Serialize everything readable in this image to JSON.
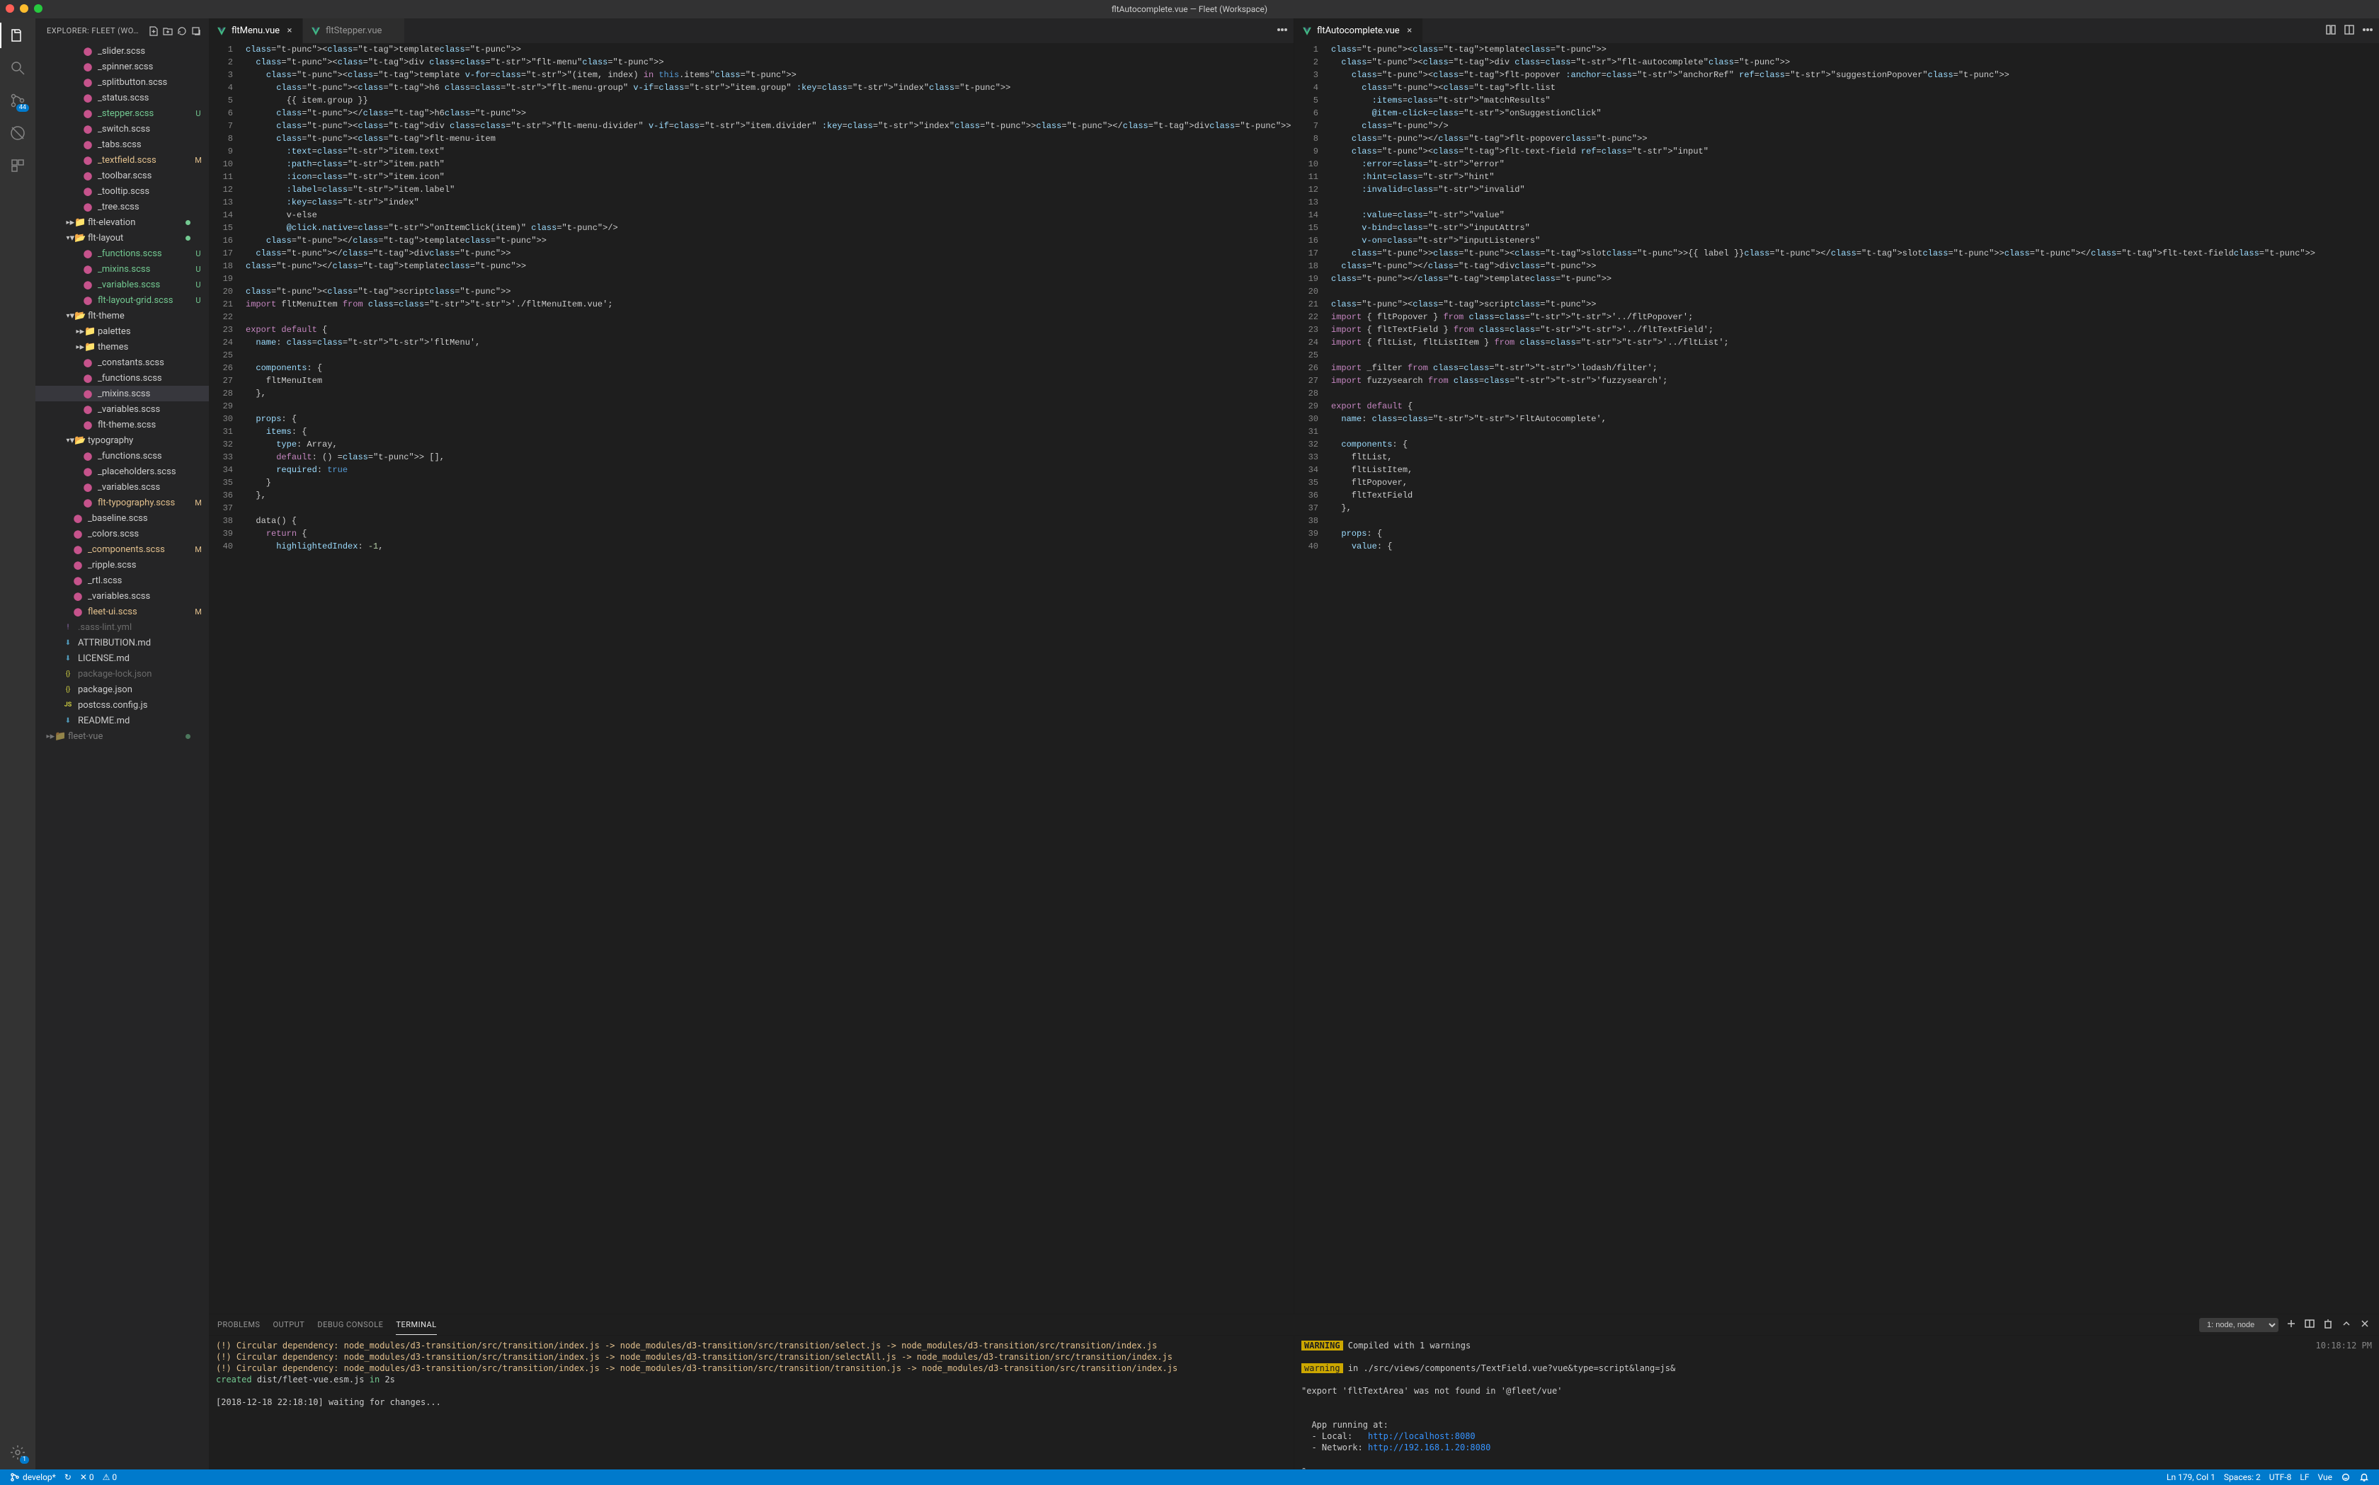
{
  "window": {
    "title": "fltAutocomplete.vue — Fleet (Workspace)"
  },
  "activity": {
    "scm_badge": "44",
    "settings_badge": "1"
  },
  "sidebar": {
    "title": "EXPLORER: FLEET (WO…",
    "items": [
      {
        "depth": 3,
        "kind": "sass",
        "name": "_slider.scss",
        "git": ""
      },
      {
        "depth": 3,
        "kind": "sass",
        "name": "_spinner.scss",
        "git": ""
      },
      {
        "depth": 3,
        "kind": "sass",
        "name": "_splitbutton.scss",
        "git": ""
      },
      {
        "depth": 3,
        "kind": "sass",
        "name": "_status.scss",
        "git": ""
      },
      {
        "depth": 3,
        "kind": "sass",
        "name": "_stepper.scss",
        "git": "U"
      },
      {
        "depth": 3,
        "kind": "sass",
        "name": "_switch.scss",
        "git": ""
      },
      {
        "depth": 3,
        "kind": "sass",
        "name": "_tabs.scss",
        "git": ""
      },
      {
        "depth": 3,
        "kind": "sass",
        "name": "_textfield.scss",
        "git": "M"
      },
      {
        "depth": 3,
        "kind": "sass",
        "name": "_toolbar.scss",
        "git": ""
      },
      {
        "depth": 3,
        "kind": "sass",
        "name": "_tooltip.scss",
        "git": ""
      },
      {
        "depth": 3,
        "kind": "sass",
        "name": "_tree.scss",
        "git": ""
      },
      {
        "depth": 2,
        "kind": "folder-closed",
        "name": "flt-elevation",
        "git": "",
        "dot": true
      },
      {
        "depth": 2,
        "kind": "folder-open",
        "name": "flt-layout",
        "git": "",
        "dot": true
      },
      {
        "depth": 3,
        "kind": "sass",
        "name": "_functions.scss",
        "git": "U"
      },
      {
        "depth": 3,
        "kind": "sass",
        "name": "_mixins.scss",
        "git": "U"
      },
      {
        "depth": 3,
        "kind": "sass",
        "name": "_variables.scss",
        "git": "U"
      },
      {
        "depth": 3,
        "kind": "sass",
        "name": "flt-layout-grid.scss",
        "git": "U"
      },
      {
        "depth": 2,
        "kind": "folder-open",
        "name": "flt-theme",
        "git": ""
      },
      {
        "depth": 3,
        "kind": "folder-closed",
        "name": "palettes",
        "git": ""
      },
      {
        "depth": 3,
        "kind": "folder-closed",
        "name": "themes",
        "git": ""
      },
      {
        "depth": 3,
        "kind": "sass",
        "name": "_constants.scss",
        "git": ""
      },
      {
        "depth": 3,
        "kind": "sass",
        "name": "_functions.scss",
        "git": ""
      },
      {
        "depth": 3,
        "kind": "sass",
        "name": "_mixins.scss",
        "git": "",
        "selected": true
      },
      {
        "depth": 3,
        "kind": "sass",
        "name": "_variables.scss",
        "git": ""
      },
      {
        "depth": 3,
        "kind": "sass",
        "name": "flt-theme.scss",
        "git": ""
      },
      {
        "depth": 2,
        "kind": "folder-open",
        "name": "typography",
        "git": ""
      },
      {
        "depth": 3,
        "kind": "sass",
        "name": "_functions.scss",
        "git": ""
      },
      {
        "depth": 3,
        "kind": "sass",
        "name": "_placeholders.scss",
        "git": ""
      },
      {
        "depth": 3,
        "kind": "sass",
        "name": "_variables.scss",
        "git": ""
      },
      {
        "depth": 3,
        "kind": "sass",
        "name": "flt-typography.scss",
        "git": "M"
      },
      {
        "depth": 2,
        "kind": "sass",
        "name": "_baseline.scss",
        "git": ""
      },
      {
        "depth": 2,
        "kind": "sass",
        "name": "_colors.scss",
        "git": ""
      },
      {
        "depth": 2,
        "kind": "sass",
        "name": "_components.scss",
        "git": "M"
      },
      {
        "depth": 2,
        "kind": "sass",
        "name": "_ripple.scss",
        "git": ""
      },
      {
        "depth": 2,
        "kind": "sass",
        "name": "_rtl.scss",
        "git": ""
      },
      {
        "depth": 2,
        "kind": "sass",
        "name": "_variables.scss",
        "git": ""
      },
      {
        "depth": 2,
        "kind": "sass",
        "name": "fleet-ui.scss",
        "git": "M"
      },
      {
        "depth": 1,
        "kind": "yml",
        "name": ".sass-lint.yml",
        "git": "",
        "ignored": true
      },
      {
        "depth": 1,
        "kind": "md",
        "name": "ATTRIBUTION.md",
        "git": ""
      },
      {
        "depth": 1,
        "kind": "md",
        "name": "LICENSE.md",
        "git": ""
      },
      {
        "depth": 1,
        "kind": "json",
        "name": "package-lock.json",
        "git": "",
        "ignored": true
      },
      {
        "depth": 1,
        "kind": "json",
        "name": "package.json",
        "git": ""
      },
      {
        "depth": 1,
        "kind": "js",
        "name": "postcss.config.js",
        "git": ""
      },
      {
        "depth": 1,
        "kind": "md",
        "name": "README.md",
        "git": ""
      },
      {
        "depth": 0,
        "kind": "folder-closed",
        "name": "fleet-vue",
        "git": "",
        "dot": true,
        "cut": true
      }
    ]
  },
  "editors": {
    "left": {
      "tabs": [
        {
          "name": "fltMenu.vue",
          "active": true,
          "close": true,
          "icon": "vue"
        },
        {
          "name": "fltStepper.vue",
          "active": false,
          "close": false,
          "icon": "vue"
        }
      ],
      "lines": [
        "<template>",
        "  <div class=\"flt-menu\">",
        "    <template v-for=\"(item, index) in this.items\">",
        "      <h6 class=\"flt-menu-group\" v-if=\"item.group\" :key=\"index\">",
        "        {{ item.group }}",
        "      </h6>",
        "      <div class=\"flt-menu-divider\" v-if=\"item.divider\" :key=\"index\"></div>",
        "      <flt-menu-item",
        "        :text=\"item.text\"",
        "        :path=\"item.path\"",
        "        :icon=\"item.icon\"",
        "        :label=\"item.label\"",
        "        :key=\"index\"",
        "        v-else",
        "        @click.native=\"onItemClick(item)\" />",
        "    </template>",
        "  </div>",
        "</template>",
        "",
        "<script>",
        "import fltMenuItem from './fltMenuItem.vue';",
        "",
        "export default {",
        "  name: 'fltMenu',",
        "",
        "  components: {",
        "    fltMenuItem",
        "  },",
        "",
        "  props: {",
        "    items: {",
        "      type: Array,",
        "      default: () => [],",
        "      required: true",
        "    }",
        "  },",
        "",
        "  data() {",
        "    return {",
        "      highlightedIndex: -1,"
      ]
    },
    "right": {
      "tabs": [
        {
          "name": "fltAutocomplete.vue",
          "active": true,
          "close": true,
          "icon": "vue"
        }
      ],
      "lines": [
        "<template>",
        "  <div class=\"flt-autocomplete\">",
        "    <flt-popover :anchor=\"anchorRef\" ref=\"suggestionPopover\">",
        "      <flt-list",
        "        :items=\"matchResults\"",
        "        @item-click=\"onSuggestionClick\"",
        "      />",
        "    </flt-popover>",
        "    <flt-text-field ref=\"input\"",
        "      :error=\"error\"",
        "      :hint=\"hint\"",
        "      :invalid=\"invalid\"",
        "",
        "      :value=\"value\"",
        "      v-bind=\"inputAttrs\"",
        "      v-on=\"inputListeners\"",
        "    ><slot>{{ label }}</slot></flt-text-field>",
        "  </div>",
        "</template>",
        "",
        "<script>",
        "import { fltPopover } from '../fltPopover';",
        "import { fltTextField } from '../fltTextField';",
        "import { fltList, fltListItem } from '../fltList';",
        "",
        "import _filter from 'lodash/filter';",
        "import fuzzysearch from 'fuzzysearch';",
        "",
        "export default {",
        "  name: 'FltAutocomplete',",
        "",
        "  components: {",
        "    fltList,",
        "    fltListItem,",
        "    fltPopover,",
        "    fltTextField",
        "  },",
        "",
        "  props: {",
        "    value: {"
      ]
    }
  },
  "panel": {
    "tabs": {
      "problems": "Problems",
      "output": "Output",
      "debug": "Debug Console",
      "terminal": "Terminal"
    },
    "terminal_select": "1: node, node",
    "left_term": [
      {
        "cls": "ylw",
        "text": "(!) Circular dependency: node_modules/d3-transition/src/transition/index.js -> node_modules/d3-transition/src/transition/select.js -> node_modules/d3-transition/src/transition/index.js"
      },
      {
        "cls": "ylw",
        "text": "(!) Circular dependency: node_modules/d3-transition/src/transition/index.js -> node_modules/d3-transition/src/transition/selectAll.js -> node_modules/d3-transition/src/transition/index.js"
      },
      {
        "cls": "ylw",
        "text": "(!) Circular dependency: node_modules/d3-transition/src/transition/index.js -> node_modules/d3-transition/src/transition/transition.js -> node_modules/d3-transition/src/transition/index.js"
      },
      {
        "cls": "grn",
        "text": "created dist/fleet-vue.esm.js in 2s"
      },
      {
        "cls": "dim",
        "text": ""
      },
      {
        "cls": "dim",
        "text": "[2018-12-18 22:18:10] waiting for changes..."
      }
    ],
    "right_term": {
      "time": "10:18:12 PM",
      "line1_a": "WARNING",
      "line1_b": " Compiled with 1 warnings",
      "line2_a": "warning",
      "line2_b": " in ./src/views/components/TextField.vue?vue&type=script&lang=js&",
      "line3": "\"export 'fltTextArea' was not found in '@fleet/vue'",
      "run_head": "  App running at:",
      "run_local_l": "  - Local:   ",
      "run_local_u": "http://localhost:8080",
      "run_net_l": "  - Network: ",
      "run_net_u": "http://192.168.1.20:8080",
      "cursor": "▯"
    }
  },
  "status": {
    "branch": "develop*",
    "sync": "↻",
    "errors": "✕ 0",
    "warnings": "⚠ 0",
    "lncol": "Ln 179, Col 1",
    "spaces": "Spaces: 2",
    "encoding": "UTF-8",
    "eol": "LF",
    "lang": "Vue"
  }
}
